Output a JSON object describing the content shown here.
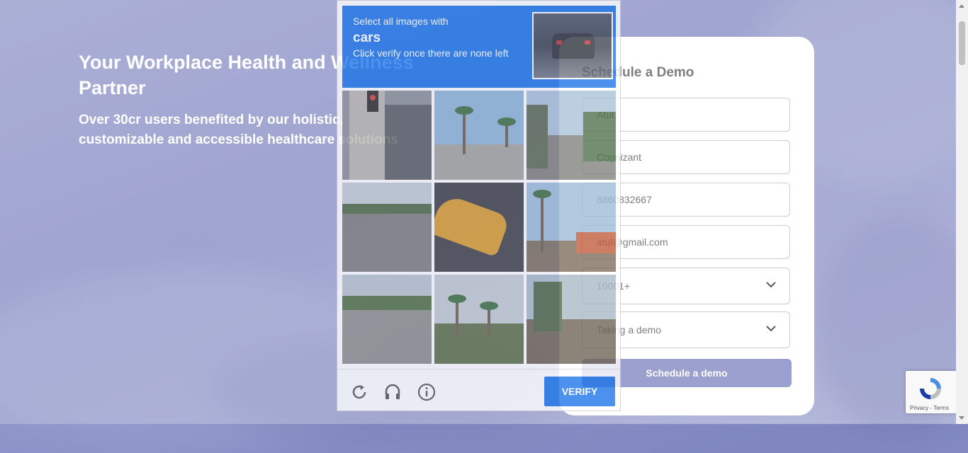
{
  "hero": {
    "title": "Your Workplace Health and Wellness Partner",
    "subtitle": "Over 30cr users benefited by our holistic, customizable and accessible healthcare solutions"
  },
  "form": {
    "title": "Schedule a Demo",
    "fields": [
      {
        "name": "name-field",
        "value": "Atul"
      },
      {
        "name": "company-field",
        "value": "Cognizant"
      },
      {
        "name": "phone-field",
        "value": "8860832667"
      },
      {
        "name": "email-field",
        "value": "atul@gmail.com"
      }
    ],
    "selects": [
      {
        "name": "employee-count-select",
        "value": "10001+"
      },
      {
        "name": "purpose-select",
        "value": "Taking a demo"
      }
    ],
    "submit_label": "Schedule a demo"
  },
  "captcha": {
    "prompt_line1": "Select all images with",
    "target": "cars",
    "prompt_line2": "Click verify once there are none left",
    "verify_label": "VERIFY",
    "icons": [
      "reload-icon",
      "audio-icon",
      "info-icon"
    ]
  },
  "recaptcha_badge": {
    "text": "Privacy - Terms"
  },
  "colors": {
    "captcha_blue": "#1a73e8",
    "submit_purple": "#7b80bf",
    "background": "#8f95c9"
  }
}
